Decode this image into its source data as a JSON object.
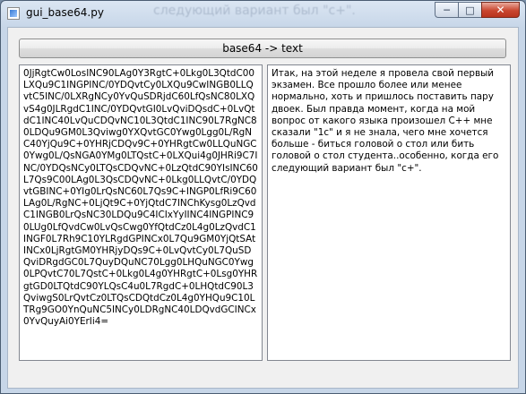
{
  "window": {
    "title": "gui_base64.py",
    "background_caption": "следующий вариант был \"с+\".",
    "controls": {
      "minimize_icon": "minimize-icon",
      "maximize_icon": "maximize-icon",
      "close_icon": "close-icon"
    }
  },
  "toolbar": {
    "convert_label": "base64 -> text"
  },
  "editors": {
    "base64_text": "0JjRgtCw0LosINC90LAg0Y3RgtC+0Lkg0L3QtdC00LXQu9C1INGPINC/0YDQvtCy0LXQu9CwINGB0LLQvtC5INC/0LXRgNCy0YvQuSDRjdC60LfQsNC80LXQvS4g0JLRgdC1INC/0YDQvtGI0LvQviDQsdC+0LvQtdC1INC40LvQuCDQvNC10L3QtdC1INC90L7RgNC80LDQu9GM0L3Qviwg0YXQvtGC0Ywg0Lgg0L/RgNC40YjQu9C+0YHRjCDQv9C+0YHRgtCw0LLQuNGC0Ywg0L/QsNGA0YMg0LTQstC+0LXQui4g0JHRi9C7INC/0YDQsNCy0LTQsCDQvNC+0LzQtdC90YIsINC60L7Qs9C00LAg0L3QsCDQvNC+0Lkg0LLQvtC/0YDQvtGBINC+0YIg0LrQsNC60L7Qs9C+INGP0LfRi9C60LAg0L/RgNC+0LjQt9C+0YjQtdC7INChKysg0LzQvdC1INGB0LrQsNC30LDQu9C4ICIxYyIINC4INGPINC90LUg0LfQvdCw0LvQsCwg0YfQtdCz0L4g0LzQvdC1INGF0L7Rh9C10YLRgdGPINCx0L7Qu9GM0YjQtSAtINCx0LjRgtGM0YHRjyDQs9C+0LvQvtCy0L7QuSDQviDRgdGC0L7QuyDQuNC70Lgg0LHQuNGC0Ywg0LPQvtC70L7QstC+0Lkg0L4g0YHRgtC+0Lsg0YHRgtGD0LTQtdC90YLQsC4u0L7RgdC+0LHQtdC90L3QviwgS0LrQvtCz0LTQsCDQtdCz0L4g0YHQu9C10LTRg9GO0YnQuNC5INCy0LDRgNC40LDQvdGCINCx0YvQuyAi0YErIi4=",
    "decoded_text": "Итак, на этой неделе я провела свой первый экзамен. Все прошло более или менее нормально, хоть и пришлось поставить пару двоек. Был правда момент, когда на мой вопрос от какого языка произошел С++ мне сказали \"1с\" и я не знала, чего мне хочется больше - биться головой о стол или бить головой о стол студента..особенно, когда его следующий вариант был \"с+\"."
  }
}
